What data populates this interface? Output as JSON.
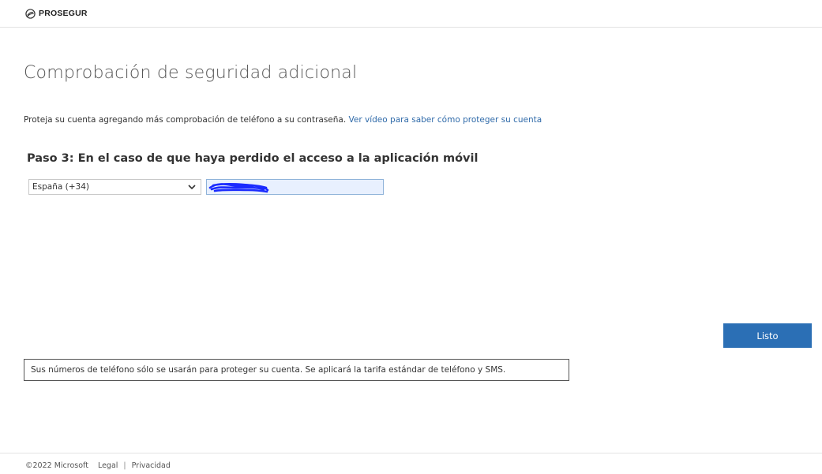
{
  "header": {
    "brand": "PROSEGUR"
  },
  "page_title": "Comprobación de seguridad adicional",
  "intro": {
    "text": "Proteja su cuenta agregando más comprobación de teléfono a su contraseña.",
    "link": "Ver vídeo para saber cómo proteger su cuenta"
  },
  "step": {
    "heading": "Paso 3: En el caso de que haya perdido el acceso a la aplicación móvil",
    "country_select": {
      "value": "España (+34)"
    },
    "phone_input": {
      "value": ""
    }
  },
  "actions": {
    "done_label": "Listo"
  },
  "notice": "Sus números de teléfono sólo se usarán para proteger su cuenta. Se aplicará la tarifa estándar de teléfono y SMS.",
  "footer": {
    "copyright": "©2022 Microsoft",
    "legal": "Legal",
    "separator": "|",
    "privacy": "Privacidad"
  },
  "colors": {
    "link": "#2f6aa9",
    "primary_button": "#2b6fb5",
    "phone_field_bg": "#e8f0fe",
    "redaction_scribble": "#1a2bff"
  }
}
